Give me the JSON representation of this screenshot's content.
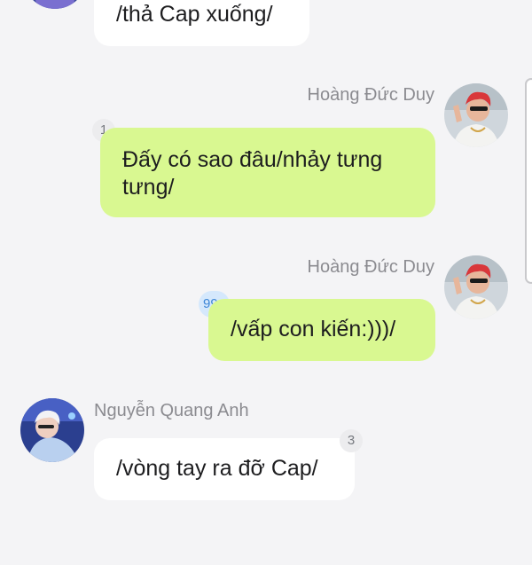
{
  "messages": [
    {
      "sender": "",
      "text": "/thả Cap xuống/",
      "badge": ""
    },
    {
      "sender": "Hoàng Đức Duy",
      "text": "Đấy có sao đâu/nhảy tưng tưng/",
      "badge": "1"
    },
    {
      "sender": "Hoàng Đức Duy",
      "text": "/vấp con kiến:)))/",
      "badge": "99+"
    },
    {
      "sender": "Nguyễn Quang Anh",
      "text": "/vòng tay ra đỡ Cap/",
      "badge": "3"
    }
  ],
  "colors": {
    "background": "#f4f4f6",
    "incoming_bubble": "#ffffff",
    "outgoing_bubble": "#d9f891",
    "sender_name": "#8b8b90",
    "badge_blue": "#3d86d6"
  }
}
